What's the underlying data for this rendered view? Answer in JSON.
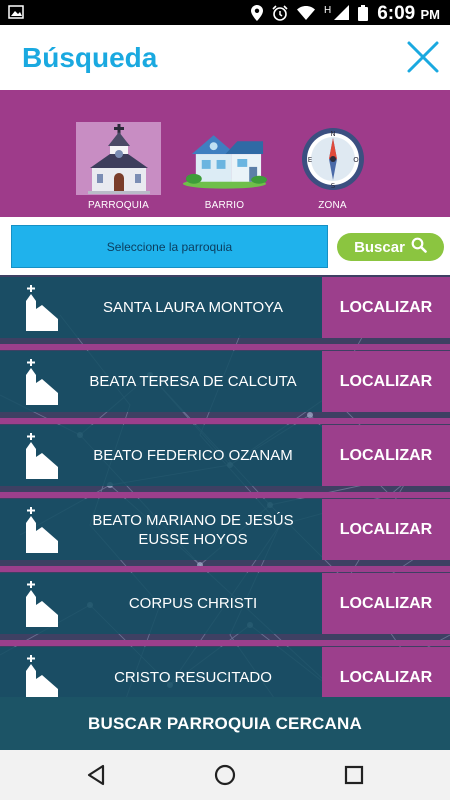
{
  "status_bar": {
    "time": "6:09",
    "ampm": "PM",
    "network": "H",
    "icons": [
      "image-icon",
      "location-icon",
      "alarm-icon",
      "wifi-icon",
      "signal-icon",
      "battery-icon"
    ]
  },
  "header": {
    "title": "Búsqueda",
    "close_icon": "close-icon",
    "accent_color": "#1aa9e0"
  },
  "categories": [
    {
      "label": "PARROQUIA",
      "icon": "church-icon",
      "selected": true
    },
    {
      "label": "BARRIO",
      "icon": "house-icon",
      "selected": false
    },
    {
      "label": "ZONA",
      "icon": "compass-icon",
      "selected": false
    }
  ],
  "search": {
    "select_placeholder": "Seleccione la parroquia",
    "button_label": "Buscar",
    "button_icon": "search-icon"
  },
  "parishes": [
    {
      "name": "SANTA LAURA MONTOYA",
      "action": "LOCALIZAR"
    },
    {
      "name": "BEATA TERESA DE CALCUTA",
      "action": "LOCALIZAR"
    },
    {
      "name": "BEATO FEDERICO OZANAM",
      "action": "LOCALIZAR"
    },
    {
      "name": "BEATO MARIANO DE JESÚS EUSSE HOYOS",
      "action": "LOCALIZAR"
    },
    {
      "name": "CORPUS CHRISTI",
      "action": "LOCALIZAR"
    },
    {
      "name": "CRISTO RESUCITADO",
      "action": "LOCALIZAR"
    }
  ],
  "bottom_button": {
    "label": "BUSCAR PARROQUIA CERCANA"
  },
  "nav_bar": {
    "icons": [
      "back-icon",
      "home-icon",
      "recents-icon"
    ]
  },
  "colors": {
    "purple": "#9e3b8a",
    "teal": "#1c5466",
    "green": "#8bc540",
    "blue": "#1fb2ec"
  }
}
